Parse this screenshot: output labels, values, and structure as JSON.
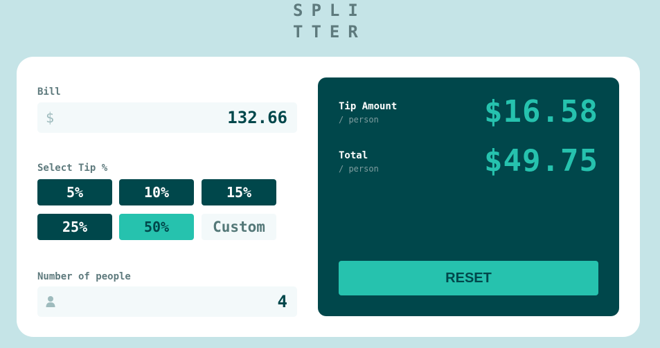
{
  "logo": {
    "line1": "SPLI",
    "line2": "TTER"
  },
  "bill": {
    "label": "Bill",
    "currency": "$",
    "value": "132.66"
  },
  "tip": {
    "label": "Select Tip %",
    "options": [
      "5%",
      "10%",
      "15%",
      "25%",
      "50%"
    ],
    "selected": "50%",
    "custom_label": "Custom"
  },
  "people": {
    "label": "Number of people",
    "value": "4"
  },
  "results": {
    "tip_amount_label": "Tip Amount",
    "tip_amount_sub": "/ person",
    "tip_amount_value": "$16.58",
    "total_label": "Total",
    "total_sub": "/ person",
    "total_value": "$49.75"
  },
  "reset_label": "RESET",
  "colors": {
    "background": "#c5e4e7",
    "dark_cyan": "#00474b",
    "strong_cyan": "#26c2ae",
    "input_bg": "#f3f9fa"
  },
  "icons": {
    "bill": "dollar-icon",
    "people": "person-icon"
  }
}
